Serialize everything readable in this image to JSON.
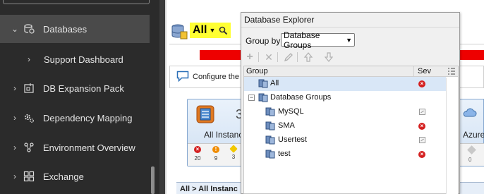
{
  "sidebar": {
    "items": [
      {
        "label": "Databases",
        "chevron": "⌄",
        "icon": "database-icon",
        "active": true
      },
      {
        "label": "Support Dashboard",
        "chevron": "›",
        "icon": "",
        "active": false
      },
      {
        "label": "DB Expansion Pack",
        "chevron": "›",
        "icon": "expansion-pack-icon",
        "active": false
      },
      {
        "label": "Dependency Mapping",
        "chevron": "›",
        "icon": "dependency-gears-icon",
        "active": false
      },
      {
        "label": "Environment Overview",
        "chevron": "›",
        "icon": "environment-nodes-icon",
        "active": false
      },
      {
        "label": "Exchange",
        "chevron": "›",
        "icon": "exchange-grid-icon",
        "active": false
      }
    ]
  },
  "main": {
    "scope_label": "All",
    "config_text": "Configure the g",
    "tile": {
      "count": "3",
      "label": "All Instance",
      "stats": [
        "20",
        "9",
        "3"
      ]
    },
    "tile_right": {
      "label": "Azure",
      "stat": "0"
    },
    "breadcrumb": "All > All Instanc"
  },
  "explorer": {
    "title": "Database Explorer",
    "group_by_label": "Group by:",
    "group_by_value": "Database Groups",
    "columns": {
      "group": "Group",
      "sev": "Sev"
    },
    "rows": [
      {
        "label": "All",
        "severity": "critical"
      },
      {
        "label": "Database Groups",
        "severity": ""
      },
      {
        "label": "MySQL",
        "severity": "unknown"
      },
      {
        "label": "SMA",
        "severity": "critical"
      },
      {
        "label": "Usertest",
        "severity": "unknown"
      },
      {
        "label": "test",
        "severity": "critical"
      }
    ],
    "toolbar": [
      "add-icon",
      "delete-icon",
      "edit-icon",
      "move-up-icon",
      "move-down-icon"
    ]
  },
  "colors": {
    "sidebar_bg": "#2b2b2b",
    "highlight": "#ffff33",
    "alarm_red": "#ee0000",
    "selected_row": "#d9e7f7"
  }
}
